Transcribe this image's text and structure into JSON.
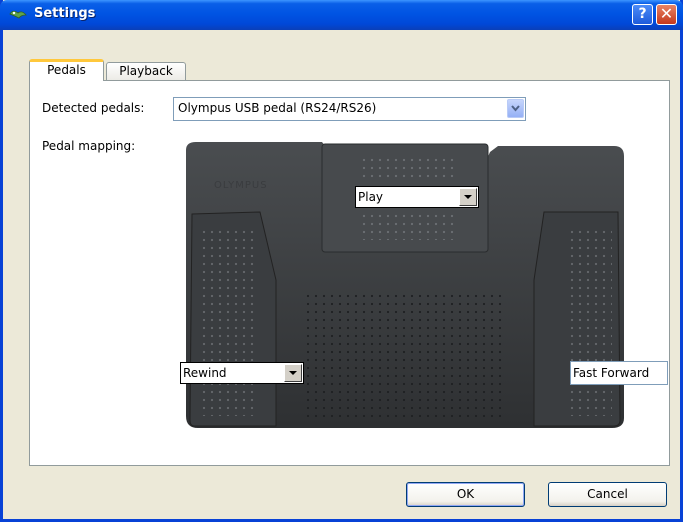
{
  "window": {
    "title": "Settings",
    "help_button": "?",
    "close_button": "✕"
  },
  "tabs": [
    {
      "label": "Pedals",
      "active": true
    },
    {
      "label": "Playback",
      "active": false
    }
  ],
  "pedals_tab": {
    "detected_label": "Detected pedals:",
    "detected_value": "Olympus USB pedal (RS24/RS26)",
    "mapping_label": "Pedal mapping:",
    "pedal_brand_print": "OLYMPUS",
    "center_pedal": "Play",
    "left_pedal": "Rewind",
    "right_pedal": "Fast Forward"
  },
  "buttons": {
    "ok": "OK",
    "cancel": "Cancel"
  },
  "colors": {
    "titlebar": "#0054E3",
    "tab_highlight": "#FFC83C",
    "dialog_bg": "#ECE9D8"
  }
}
